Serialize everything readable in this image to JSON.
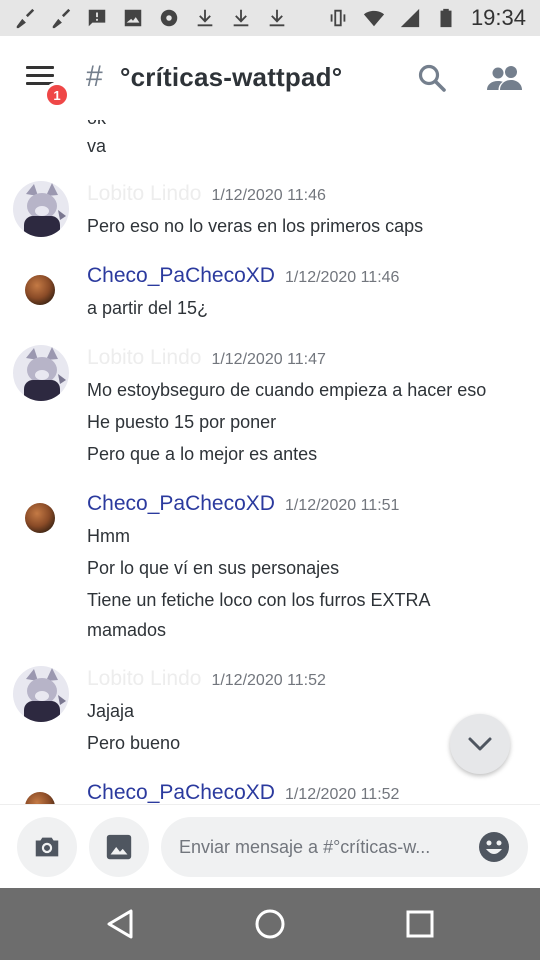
{
  "status_bar": {
    "time": "19:34",
    "left_icons": [
      "broom-icon",
      "broom-icon",
      "chat-alert-icon",
      "image-icon",
      "speed-icon",
      "download-icon",
      "download-icon",
      "download-icon"
    ],
    "right_icons": [
      "vibrate-icon",
      "wifi-icon",
      "signal-icon",
      "battery-icon"
    ]
  },
  "header": {
    "badge_count": "1",
    "hash_symbol": "#",
    "channel_name": "°críticas-wattpad°"
  },
  "messages": {
    "partial_top": "ok",
    "first_line": "va",
    "groups": [
      {
        "author": "Lobito Lindo",
        "timestamp": "1/12/2020 11:46",
        "lines": [
          "Pero eso no lo veras en los primeros caps"
        ]
      },
      {
        "author": "Checo_PaChecoXD",
        "timestamp": "1/12/2020 11:46",
        "lines": [
          "a partir del 15¿"
        ]
      },
      {
        "author": "Lobito Lindo",
        "timestamp": "1/12/2020 11:47",
        "lines": [
          "Mo estoybseguro de cuando empieza a hacer eso",
          "He puesto 15 por poner",
          "Pero que a lo mejor es antes"
        ]
      },
      {
        "author": "Checo_PaChecoXD",
        "timestamp": "1/12/2020 11:51",
        "lines": [
          "Hmm",
          "Por lo que ví en sus personajes",
          "Tiene un fetiche loco con los furros EXTRA",
          "mamados"
        ]
      },
      {
        "author": "Lobito Lindo",
        "timestamp": "1/12/2020 11:52",
        "lines": [
          "Jajaja",
          "Pero bueno"
        ]
      },
      {
        "author": "Checo_PaChecoXD",
        "timestamp": "1/12/2020 11:52",
        "lines": []
      }
    ]
  },
  "composer": {
    "placeholder": "Enviar mensaje a #°críticas-w..."
  },
  "colors": {
    "author_link": "#2b3a9e",
    "badge_red": "#ef4747",
    "status_bar_bg": "#e6e6e6",
    "nav_bar_bg": "#6d6d6d"
  }
}
